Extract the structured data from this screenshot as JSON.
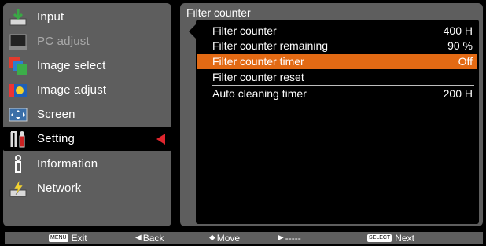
{
  "left_menu": {
    "items": [
      {
        "label": "Input",
        "icon": "input-icon"
      },
      {
        "label": "PC adjust",
        "icon": "pc-adjust-icon"
      },
      {
        "label": "Image select",
        "icon": "image-select-icon"
      },
      {
        "label": "Image adjust",
        "icon": "image-adjust-icon"
      },
      {
        "label": "Screen",
        "icon": "screen-icon"
      },
      {
        "label": "Setting",
        "icon": "setting-icon"
      },
      {
        "label": "Information",
        "icon": "information-icon"
      },
      {
        "label": "Network",
        "icon": "network-icon"
      }
    ],
    "selected_index": 5,
    "disabled_index": 1
  },
  "panel": {
    "title": "Filter counter",
    "rows": [
      {
        "label": "Filter counter",
        "value": "400 H"
      },
      {
        "label": "Filter counter remaining",
        "value": "90 %"
      },
      {
        "label": "Filter counter timer",
        "value": "Off"
      },
      {
        "label": "Filter counter reset",
        "value": ""
      },
      {
        "label": "Auto cleaning timer",
        "value": "200 H"
      }
    ],
    "highlighted_index": 2
  },
  "bottom_bar": {
    "exit_key": "MENU",
    "exit": "Exit",
    "back": "Back",
    "move": "Move",
    "next_arrow": "-----",
    "select_key": "SELECT",
    "next": "Next"
  },
  "colors": {
    "panel_gray": "#5e5e5e",
    "highlight_orange": "#e36a14",
    "active_arrow_red": "#e0262e"
  }
}
